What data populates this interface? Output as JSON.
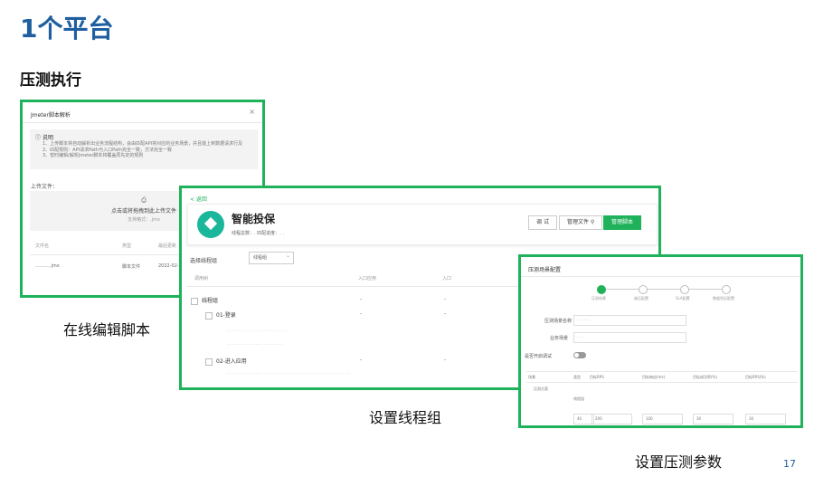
{
  "slide": {
    "title": "1个平台",
    "section": "压测执行",
    "page_number": "17",
    "captions": {
      "editor": "在线编辑脚本",
      "thread_group": "设置线程组",
      "params": "设置压测参数"
    }
  },
  "panel1": {
    "header": "Jmeter脚本解析",
    "close": "×",
    "note_title": "说明",
    "note_lines": [
      "1、上传脚本将自动解析出业务流程结构，会由匹配API将对应的业务场景，并且能上到数据请求行及",
      "2、匹配规则：API请求Path与入口Path完全一致，方法完全一致",
      "3、暂时编辑/解析Jmeter脚本将覆盖原先定的规则"
    ],
    "upload_label": "上传文件：",
    "drop_title": "点击或将拖拽到此上传文件",
    "drop_sub": "支持格式：.jmx",
    "columns": [
      "文件名",
      "类型",
      "最后更新"
    ],
    "row": [
      "...........jmx",
      "脚本文件",
      "2022-02-1"
    ]
  },
  "panel2": {
    "back": "< 返回",
    "name": "智能投保",
    "sub": "线程总数：.      匹配进度：. .",
    "buttons": {
      "debug": "调 试",
      "manage": "管理文件 ⚲",
      "script": "管理脚本"
    },
    "filter_label": "选择线程组",
    "filter_value": "线程组",
    "columns": [
      "调用树",
      "入口应用",
      "入口"
    ],
    "rows": [
      {
        "label": "线程组"
      },
      {
        "label": "01-登录"
      },
      {
        "label": "02-进入应用"
      }
    ],
    "dash": "-"
  },
  "panel3": {
    "header": "压测场景配置",
    "steps": [
      "压测场景",
      "施压配置",
      "SLA配置",
      "数据验证配置"
    ],
    "fields": [
      "压测场景名称",
      "业务场景",
      "是否开启调试"
    ],
    "columns": [
      "场景",
      "类型",
      "目标RPS",
      "目标响应(ms)",
      "目标成功率(%)",
      "目标RPS(%)"
    ],
    "row_label": "压测方案",
    "row_type": "线程组",
    "values": [
      "40",
      "200",
      "100",
      "30",
      "30"
    ]
  }
}
